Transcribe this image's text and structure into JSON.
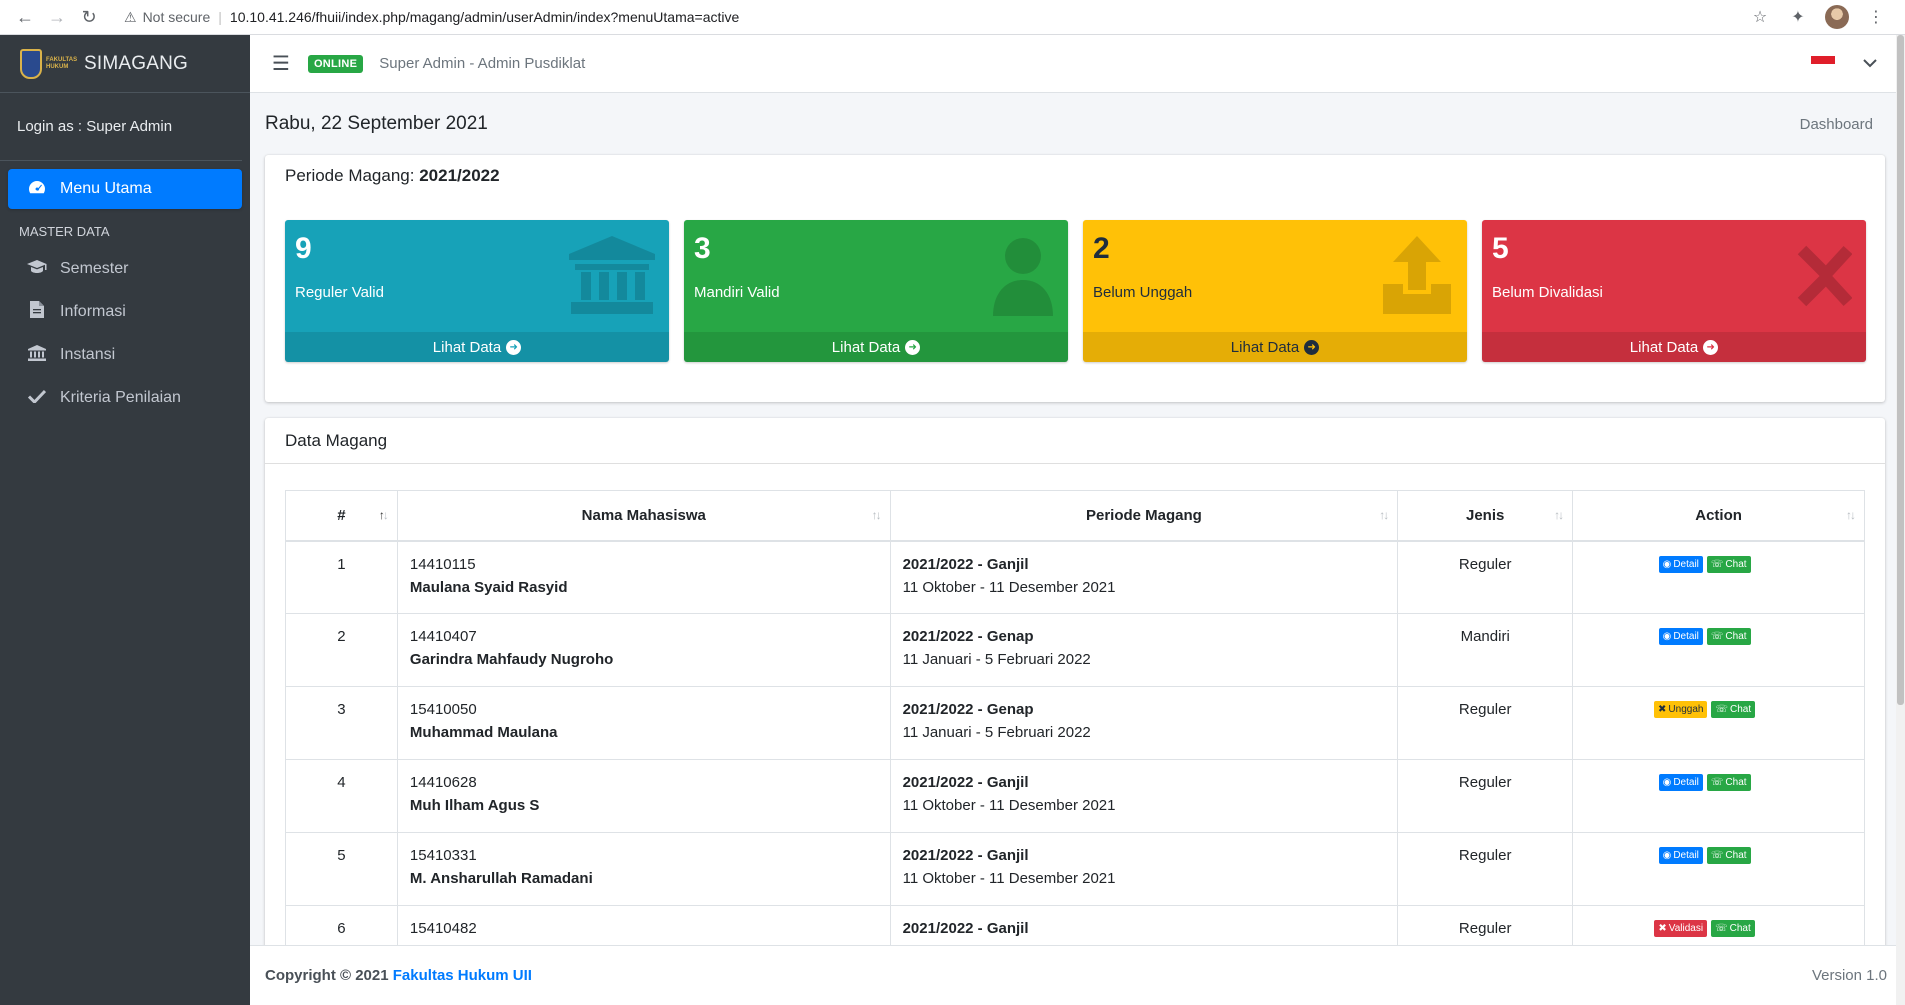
{
  "browser": {
    "security": "Not secure",
    "url": "10.10.41.246/fhuii/index.php/magang/admin/userAdmin/index?menuUtama=active"
  },
  "sidebar": {
    "brand": "SIMAGANG",
    "logo_text_1": "FAKULTAS",
    "logo_text_2": "HUKUM",
    "login_as": "Login as : Super Admin",
    "active_item": "Menu Utama",
    "section_header": "MASTER DATA",
    "items": [
      {
        "label": "Semester",
        "icon": "graduation-cap-icon"
      },
      {
        "label": "Informasi",
        "icon": "file-icon"
      },
      {
        "label": "Instansi",
        "icon": "institution-icon"
      },
      {
        "label": "Kriteria Penilaian",
        "icon": "check-icon"
      }
    ]
  },
  "navbar": {
    "status_badge": "ONLINE",
    "title": "Super Admin - Admin Pusdiklat"
  },
  "content": {
    "date": "Rabu, 22 September 2021",
    "breadcrumb": "Dashboard"
  },
  "periode": {
    "label": "Periode Magang:",
    "value": "2021/2022"
  },
  "stats": [
    {
      "value": "9",
      "label": "Reguler Valid",
      "link": "Lihat Data",
      "color": "#17a2b8"
    },
    {
      "value": "3",
      "label": "Mandiri Valid",
      "link": "Lihat Data",
      "color": "#28a745"
    },
    {
      "value": "2",
      "label": "Belum Unggah",
      "link": "Lihat Data",
      "color": "#ffc107"
    },
    {
      "value": "5",
      "label": "Belum Divalidasi",
      "link": "Lihat Data",
      "color": "#dc3545"
    }
  ],
  "table": {
    "title": "Data Magang",
    "columns": [
      "#",
      "Nama Mahasiswa",
      "Periode Magang",
      "Jenis",
      "Action"
    ],
    "rows": [
      {
        "no": "1",
        "nim": "14410115",
        "name": "Maulana Syaid Rasyid",
        "periode": "2021/2022 - Ganjil",
        "tanggal": "11 Oktober - 11 Desember 2021",
        "jenis": "Reguler",
        "action": "Detail",
        "chat": "Chat"
      },
      {
        "no": "2",
        "nim": "14410407",
        "name": "Garindra Mahfaudy Nugroho",
        "periode": "2021/2022 - Genap",
        "tanggal": "11 Januari - 5 Februari 2022",
        "jenis": "Mandiri",
        "action": "Detail",
        "chat": "Chat"
      },
      {
        "no": "3",
        "nim": "15410050",
        "name": "Muhammad Maulana",
        "periode": "2021/2022 - Genap",
        "tanggal": "11 Januari - 5 Februari 2022",
        "jenis": "Reguler",
        "action": "Unggah",
        "chat": "Chat"
      },
      {
        "no": "4",
        "nim": "14410628",
        "name": "Muh Ilham Agus S",
        "periode": "2021/2022 - Ganjil",
        "tanggal": "11 Oktober - 11 Desember 2021",
        "jenis": "Reguler",
        "action": "Detail",
        "chat": "Chat"
      },
      {
        "no": "5",
        "nim": "15410331",
        "name": "M. Ansharullah Ramadani",
        "periode": "2021/2022 - Ganjil",
        "tanggal": "11 Oktober - 11 Desember 2021",
        "jenis": "Reguler",
        "action": "Detail",
        "chat": "Chat"
      },
      {
        "no": "6",
        "nim": "15410482",
        "name": "",
        "periode": "2021/2022 - Ganjil",
        "tanggal": "",
        "jenis": "Reguler",
        "action": "Validasi",
        "chat": "Chat"
      }
    ]
  },
  "footer": {
    "copyright": "Copyright © 2021",
    "org": "Fakultas Hukum UII",
    "version": "Version 1.0"
  }
}
